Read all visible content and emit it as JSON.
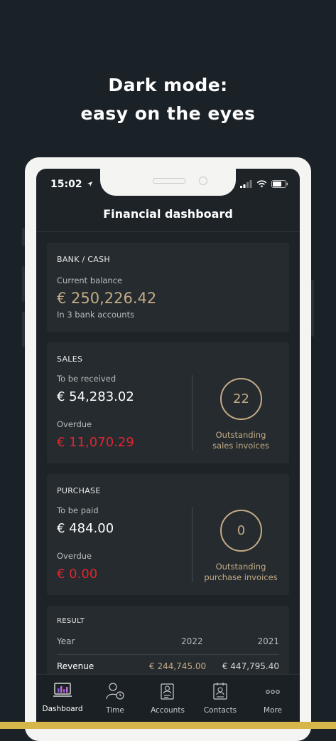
{
  "promo": {
    "line1": "Dark mode:",
    "line2": "easy on the eyes"
  },
  "status_bar": {
    "time": "15:02"
  },
  "header": {
    "title": "Financial dashboard"
  },
  "bank": {
    "title": "BANK / CASH",
    "balance_label": "Current balance",
    "balance": "€ 250,226.42",
    "accounts_note": "In 3 bank accounts"
  },
  "sales": {
    "title": "SALES",
    "receive_label": "To be received",
    "receive_amount": "€ 54,283.02",
    "overdue_label": "Overdue",
    "overdue_amount": "€ 11,070.29",
    "count": "22",
    "caption_line1": "Outstanding",
    "caption_line2": "sales invoices"
  },
  "purchase": {
    "title": "PURCHASE",
    "pay_label": "To be paid",
    "pay_amount": "€ 484.00",
    "overdue_label": "Overdue",
    "overdue_amount": "€ 0.00",
    "count": "0",
    "caption_line1": "Outstanding",
    "caption_line2": "purchase invoices"
  },
  "result": {
    "title": "RESULT",
    "year_label": "Year",
    "year_current": "2022",
    "year_previous": "2021",
    "revenue_label": "Revenue",
    "revenue_current": "€ 244,745.00",
    "revenue_previous": "€ 447,795.40"
  },
  "tabs": [
    {
      "label": "Dashboard",
      "icon": "dashboard-icon",
      "active": true
    },
    {
      "label": "Time",
      "icon": "time-icon"
    },
    {
      "label": "Accounts",
      "icon": "accounts-icon"
    },
    {
      "label": "Contacts",
      "icon": "contacts-icon"
    },
    {
      "label": "More",
      "icon": "more-icon"
    }
  ],
  "colors": {
    "background": "#1b2227",
    "card": "#252b2f",
    "gold": "#c4ab86",
    "overdue_red": "#e0262e"
  }
}
